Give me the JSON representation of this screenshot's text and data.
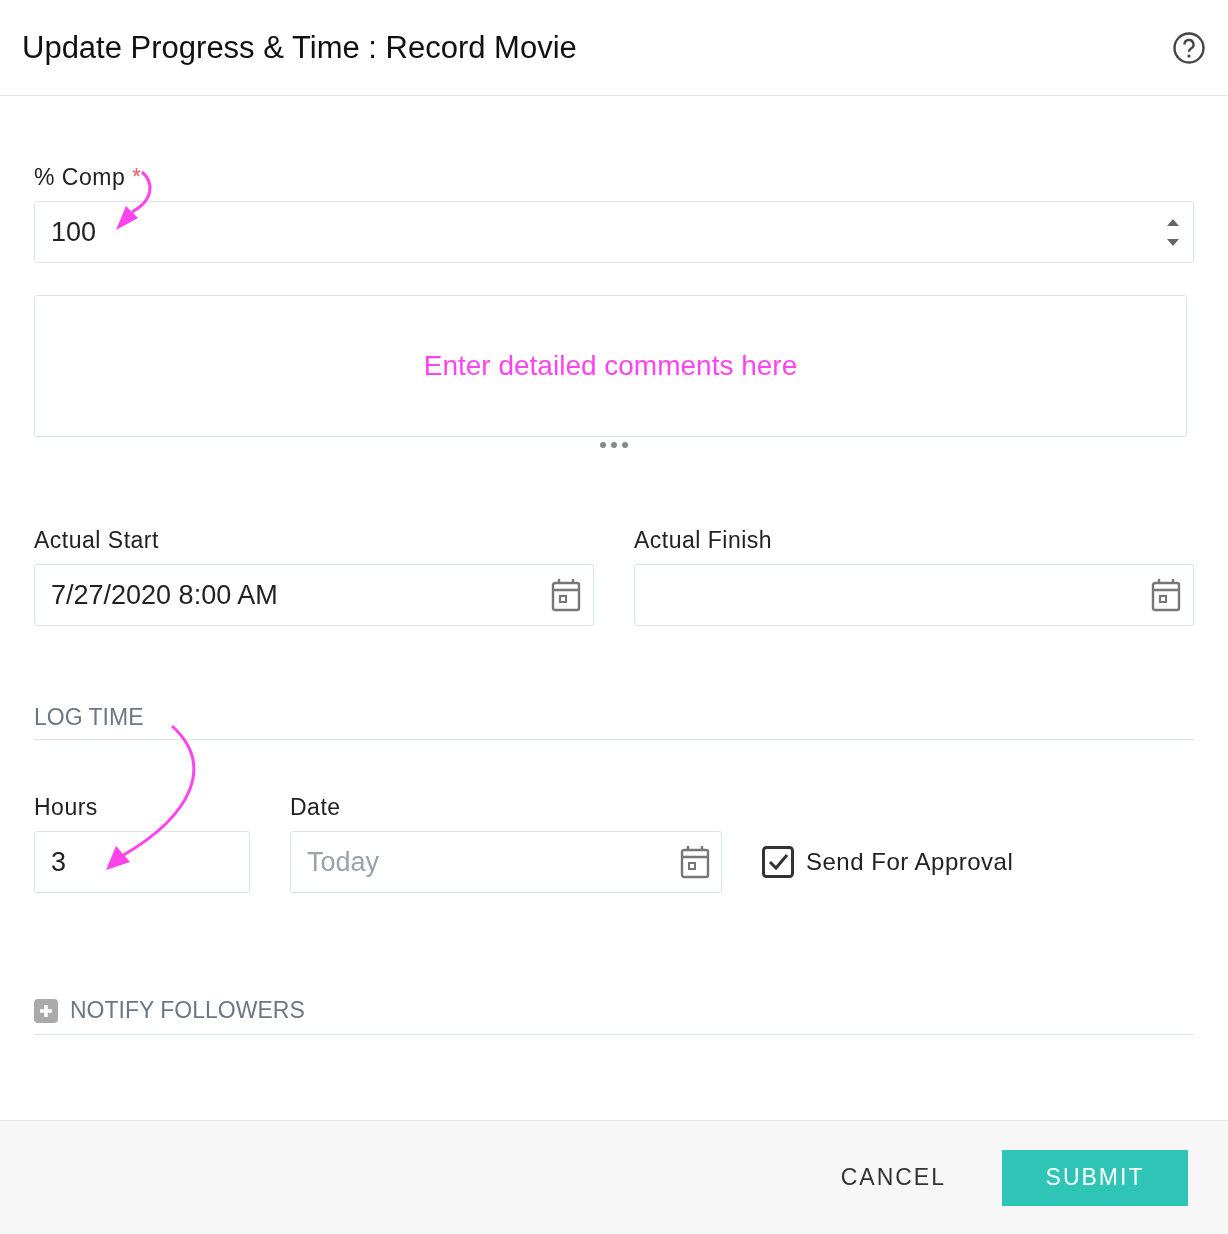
{
  "dialog": {
    "title": "Update Progress & Time : Record Movie"
  },
  "percent_complete": {
    "label": "% Comp",
    "required_mark": "*",
    "value": "100"
  },
  "comments": {
    "annotation": "Enter detailed comments here"
  },
  "actual_start": {
    "label": "Actual Start",
    "value": "7/27/2020 8:00 AM"
  },
  "actual_finish": {
    "label": "Actual Finish"
  },
  "log_time": {
    "heading": "LOG TIME",
    "hours": {
      "label": "Hours",
      "value": "3"
    },
    "date": {
      "label": "Date",
      "placeholder": "Today"
    },
    "send_for_approval": {
      "label": "Send For Approval",
      "checked": true
    }
  },
  "notify_followers": {
    "label": "NOTIFY FOLLOWERS",
    "expanded": false
  },
  "buttons": [
    {
      "label": "CANCEL",
      "kind": "text"
    },
    {
      "label": "SUBMIT",
      "kind": "primary"
    }
  ]
}
